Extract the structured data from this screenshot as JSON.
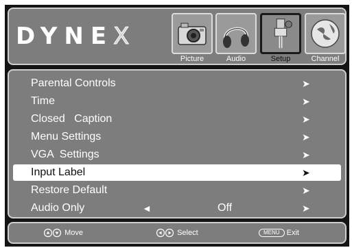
{
  "brand": {
    "logo_main": "DYNE",
    "logo_x": "X"
  },
  "tabs": [
    {
      "label": "Picture",
      "icon": "camera-icon"
    },
    {
      "label": "Audio",
      "icon": "headphones-icon"
    },
    {
      "label": "Setup",
      "icon": "setup-connector-icon",
      "active": true
    },
    {
      "label": "Channel",
      "icon": "globe-icon"
    }
  ],
  "menu": {
    "items": [
      {
        "label": "Parental Controls",
        "arrow": "➤"
      },
      {
        "label": "Time",
        "arrow": "➤"
      },
      {
        "label": "Closed   Caption",
        "arrow": "➤"
      },
      {
        "label": "Menu Settings",
        "arrow": "➤"
      },
      {
        "label": "VGA  Settings",
        "arrow": "➤"
      },
      {
        "label": "Input Label",
        "arrow": "➤",
        "selected": true
      },
      {
        "label": "Restore Default",
        "arrow": "➤"
      },
      {
        "label": "Audio Only",
        "left_arrow": "◄",
        "value": "Off",
        "arrow": "➤"
      }
    ]
  },
  "footer": {
    "move_label": "Move",
    "select_label": "Select",
    "menu_key": "MENU",
    "exit_label": "Exit"
  }
}
